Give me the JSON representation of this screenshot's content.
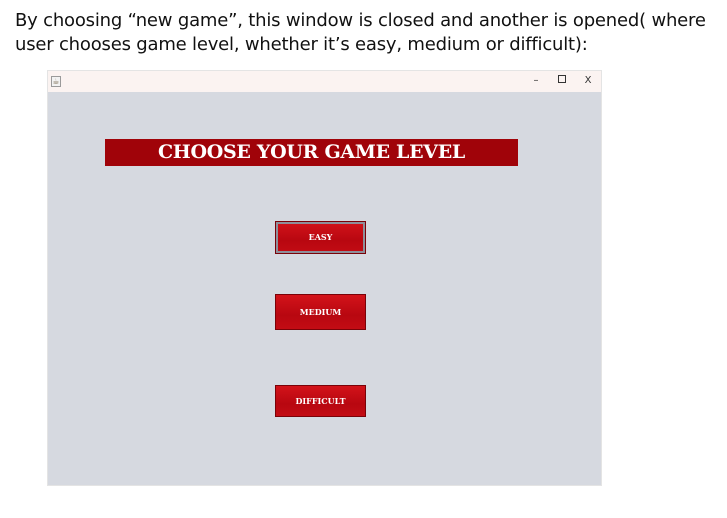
{
  "caption": {
    "text": "By choosing “new game”, this window is closed and another is opened( where user chooses game level, whether it’s easy, medium or difficult):"
  },
  "window": {
    "titlebar": {
      "icon": "java-cup-icon",
      "minimize_glyph": "–",
      "close_glyph": "X"
    },
    "banner": "CHOOSE YOUR GAME LEVEL",
    "buttons": {
      "easy": "EASY",
      "medium": "MEDIUM",
      "difficult": "DIFFICULT"
    },
    "colors": {
      "window_bg": "#d6d9e0",
      "banner_bg": "#a00309",
      "button_bg": "#c30c14"
    }
  }
}
